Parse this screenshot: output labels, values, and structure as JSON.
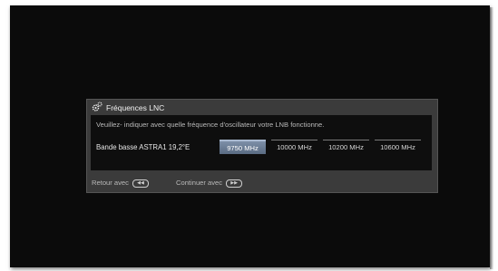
{
  "dialog": {
    "title": "Fréquences LNC",
    "hint": "Veuillez- indiquer avec quelle fréquence d'oscillateur votre LNB fonctionne.",
    "band_label": "Bande basse ASTRA1 19,2°E",
    "options": [
      {
        "label": "9750 MHz",
        "selected": true
      },
      {
        "label": "10000 MHz",
        "selected": false
      },
      {
        "label": "10200 MHz",
        "selected": false
      },
      {
        "label": "10600 MHz",
        "selected": false
      }
    ],
    "footer": {
      "back_label": "Retour avec",
      "continue_label": "Continuer avec",
      "back_key_icon": "rewind-key-icon",
      "continue_key_icon": "fast-forward-key-icon"
    }
  },
  "colors": {
    "screen_bg": "#0b0b0b",
    "dialog_bg": "#3b3b3b",
    "panel_bg": "#0e0e0e",
    "selected_bg": "#6b7c94"
  }
}
